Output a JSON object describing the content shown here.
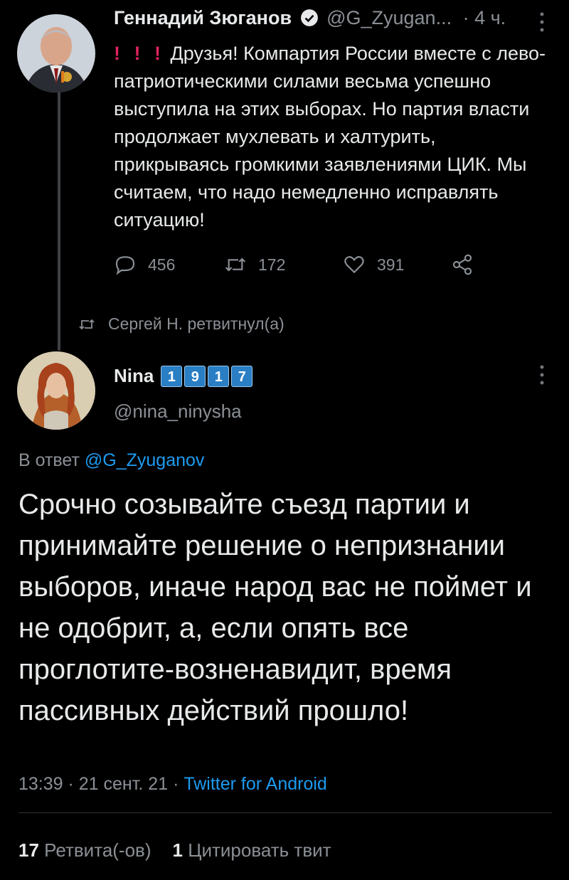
{
  "tweet1": {
    "author_name": "Геннадий Зюганов",
    "handle": "@G_Zyugan...",
    "time": "· 4 ч.",
    "excl": "! ! !",
    "text": "Друзья! Компартия России вместе с лево-патриотическими силами весьма успешно выступила на этих выборах. Но партия  власти продолжает мухлевать и халтурить, прикрываясь громкими заявлениями ЦИК. Мы считаем, что надо немедленно исправлять ситуацию!",
    "replies": "456",
    "retweets": "172",
    "likes": "391"
  },
  "retweet_note": "Сергей Н. ретвитнул(а)",
  "tweet2": {
    "author_name": "Nina",
    "digits": [
      "1",
      "9",
      "1",
      "7"
    ],
    "handle": "@nina_ninysha",
    "reply_prefix": "В ответ",
    "reply_to": "@G_Zyuganov",
    "text": "Срочно созывайте съезд партии и принимайте решение о непризнании выборов, иначе народ вас не поймет и не одобрит, а, если опять все проглотите-возненавидит, время пассивных действий прошло!",
    "timestamp": "13:39 · 21 сент. 21 ·",
    "client": "Twitter for Android",
    "retweet_count": "17",
    "retweet_label": "Ретвита(-ов)",
    "quote_count": "1",
    "quote_label": "Цитировать твит"
  },
  "colors": {
    "background": "#000000",
    "link": "#1d9bf0",
    "muted": "#8b9096",
    "exclamation": "#e0245e",
    "digit_badge": "#2a7ec4"
  }
}
